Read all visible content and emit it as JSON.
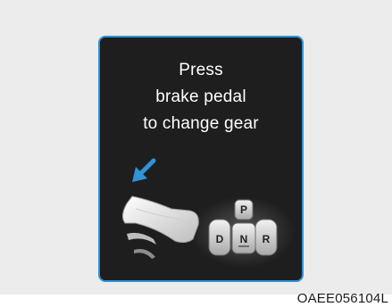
{
  "display": {
    "message_lines": [
      "Press",
      "brake pedal",
      "to change gear"
    ]
  },
  "gear_buttons": {
    "park": "P",
    "drive": "D",
    "neutral": "N",
    "reverse": "R"
  },
  "figure_code": "OAEE056104L",
  "icons": [
    "arrow-icon",
    "brake-pedal-foot-icon",
    "gear-selector-icon"
  ],
  "colors": {
    "display_border": "#2f93d6",
    "display_background": "#1e1e1e",
    "arrow": "#2f93d6",
    "text": "#ffffff"
  }
}
